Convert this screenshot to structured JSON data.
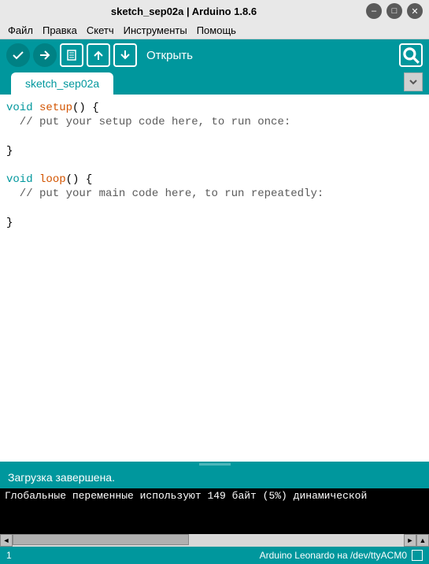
{
  "titlebar": {
    "title": "sketch_sep02a | Arduino 1.8.6"
  },
  "menu": {
    "file": "Файл",
    "edit": "Правка",
    "sketch": "Скетч",
    "tools": "Инструменты",
    "help": "Помощь"
  },
  "toolbar": {
    "label": "Открыть"
  },
  "tab": {
    "name": "sketch_sep02a"
  },
  "code": {
    "l1_kw": "void",
    "l1_fn": " setup",
    "l1_rest": "() {",
    "l2": "  // put your setup code here, to run once:",
    "l3": "",
    "l4": "}",
    "l5": "",
    "l6_kw": "void",
    "l6_fn": " loop",
    "l6_rest": "() {",
    "l7": "  // put your main code here, to run repeatedly:",
    "l8": "",
    "l9": "}"
  },
  "status": {
    "text": "Загрузка завершена."
  },
  "console": {
    "line": "Глобальные переменные используют 149 байт (5%) динамической"
  },
  "footer": {
    "line": "1",
    "board": "Arduino Leonardo на /dev/ttyACM0"
  }
}
